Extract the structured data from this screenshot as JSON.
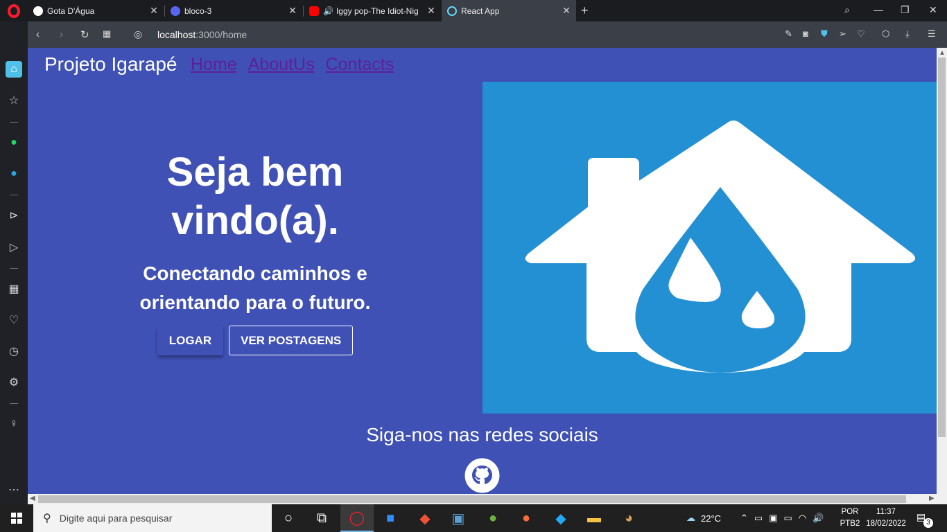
{
  "browser": {
    "tabs": [
      {
        "title": "Gota D'Água",
        "icon": "github-icon"
      },
      {
        "title": "bloco-3",
        "icon": "discord-icon"
      },
      {
        "title": "Iggy pop-The Idiot-Nig",
        "icon": "youtube-icon"
      },
      {
        "title": "React App",
        "icon": "react-icon"
      }
    ],
    "url_host": "localhost",
    "url_path": ":3000/home"
  },
  "page": {
    "brand": "Projeto Igarapé",
    "nav": [
      "Home",
      "AboutUs",
      "Contacts"
    ],
    "hero_title_line1": "Seja bem",
    "hero_title_line2": "vindo(a).",
    "hero_sub_line1": "Conectando caminhos e",
    "hero_sub_line2": "orientando para o futuro.",
    "btn_login": "LOGAR",
    "btn_posts": "VER POSTAGENS",
    "social_title": "Siga-nos nas redes sociais"
  },
  "taskbar": {
    "search_placeholder": "Digite aqui para pesquisar",
    "weather": "22°C",
    "lang1": "POR",
    "lang2": "PTB2",
    "time": "11:37",
    "date": "18/02/2022",
    "notifications": "3"
  },
  "colors": {
    "page_bg": "#3f51b5",
    "hero_image_bg": "#2290d3",
    "link": "#5e1f99"
  }
}
